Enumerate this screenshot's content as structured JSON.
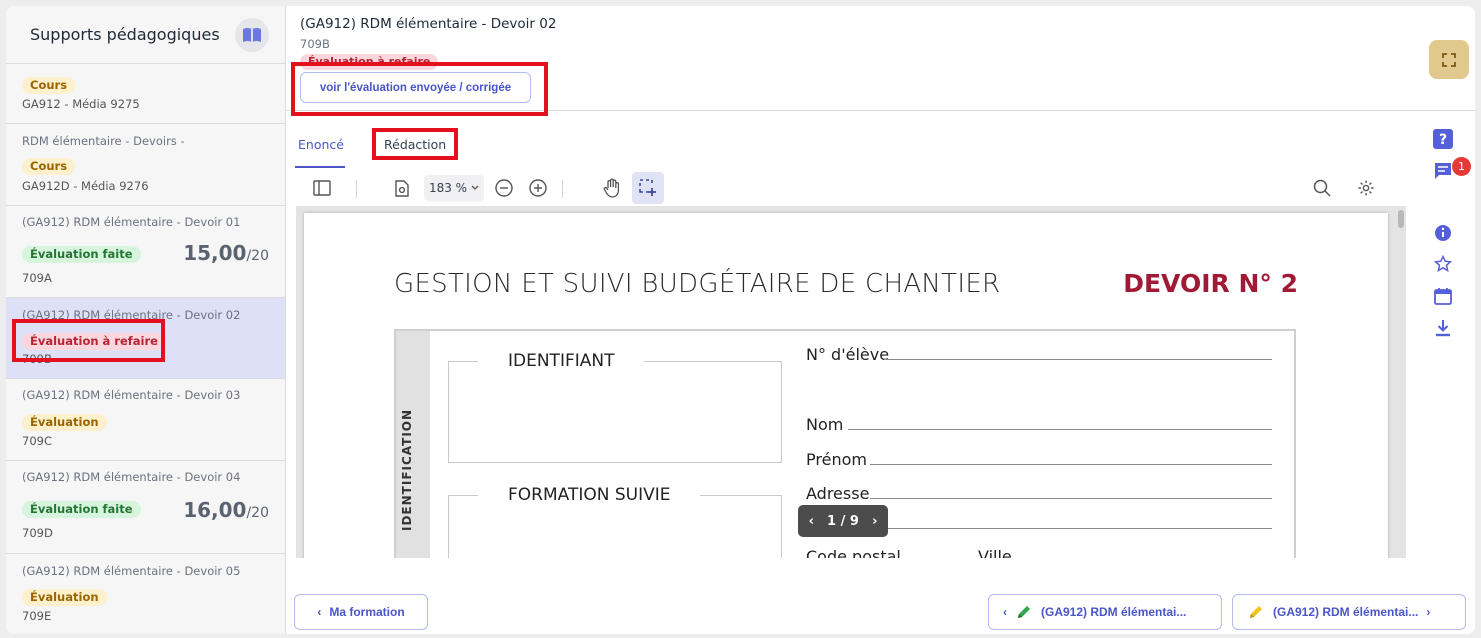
{
  "sidebar": {
    "title": "Supports pédagogiques",
    "items": [
      {
        "title": "",
        "badge": "Cours",
        "code": "GA912 - Média 9275"
      },
      {
        "title": "RDM élémentaire - Devoirs -",
        "badge": "Cours",
        "code": "GA912D - Média 9276"
      },
      {
        "title": "(GA912) RDM élémentaire - Devoir 01",
        "badge": "Évaluation faite",
        "score": "15,00",
        "score_total": "/20",
        "code": "709A"
      },
      {
        "title": "(GA912) RDM élémentaire - Devoir 02",
        "badge": "Évaluation à refaire",
        "code": "709B"
      },
      {
        "title": "(GA912) RDM élémentaire - Devoir 03",
        "badge": "Évaluation",
        "code": "709C"
      },
      {
        "title": "(GA912) RDM élémentaire - Devoir 04",
        "badge": "Évaluation faite",
        "score": "16,00",
        "score_total": "/20",
        "code": "709D"
      },
      {
        "title": "(GA912) RDM élémentaire - Devoir 05",
        "badge": "Évaluation",
        "code": "709E"
      }
    ]
  },
  "header": {
    "title": "(GA912) RDM élémentaire - Devoir 02",
    "code": "709B",
    "status": "Évaluation à refaire",
    "view_button": "voir l'évaluation envoyée / corrigée"
  },
  "tabs": {
    "enonce": "Enoncé",
    "redaction": "Rédaction"
  },
  "toolbar": {
    "zoom": "183 %"
  },
  "document": {
    "title": "GESTION ET SUIVI BUDGÉTAIRE DE CHANTIER",
    "devoir": "DEVOIR N° 2",
    "strip": "IDENTIFICATION",
    "box1": "IDENTIFIANT",
    "box2": "FORMATION SUIVIE",
    "fields": {
      "eleve": "N° d'élève",
      "nom": "Nom",
      "prenom": "Prénom",
      "adresse": "Adresse",
      "cp": "Code postal",
      "ville": "Ville"
    },
    "pager": "1 / 9"
  },
  "rail": {
    "notification_count": "1"
  },
  "footer": {
    "back": "Ma formation",
    "prev": "(GA912) RDM élémentai...",
    "next": "(GA912) RDM élémentai..."
  },
  "colors": {
    "accent": "#4a55c9",
    "annotation": "#e3101e",
    "devoir_red": "#a11a35",
    "active_item": "#dde0f7"
  }
}
